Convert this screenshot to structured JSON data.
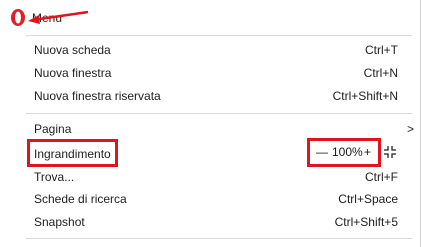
{
  "menu": {
    "title": "Menu",
    "sections": [
      {
        "items": [
          {
            "label": "Nuova scheda",
            "shortcut": "Ctrl+T"
          },
          {
            "label": "Nuova finestra",
            "shortcut": "Ctrl+N"
          },
          {
            "label": "Nuova finestra riservata",
            "shortcut": "Ctrl+Shift+N"
          }
        ]
      },
      {
        "items": [
          {
            "label": "Pagina",
            "submenu_indicator": ">"
          },
          {
            "label": "Ingrandimento",
            "zoom": {
              "minus": "—",
              "value": "100%",
              "plus": "+"
            }
          },
          {
            "label": "Trova...",
            "shortcut": "Ctrl+F"
          },
          {
            "label": "Schede di ricerca",
            "shortcut": "Ctrl+Space"
          },
          {
            "label": "Snapshot",
            "shortcut": "Ctrl+Shift+5"
          }
        ]
      }
    ]
  },
  "icons": {
    "logo": "opera-logo-icon",
    "fullscreen": "fullscreen-exit-icon",
    "chevron": "chevron-right-icon"
  },
  "colors": {
    "annotation_red": "#e0141e",
    "opera_red": "#e01f26",
    "divider": "#d9d9d9"
  }
}
